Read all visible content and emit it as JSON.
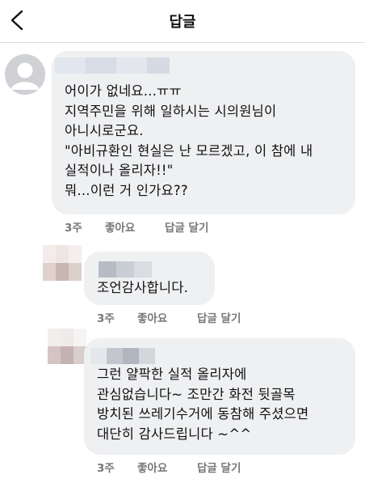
{
  "header": {
    "title": "답글",
    "back_icon": "chevron-left-icon"
  },
  "comments": [
    {
      "text": "어이가 없네요...ㅠㅠ\n지역주민을 위해 일하시는 시의원님이\n아니시로군요.\n\"아비규환인 현실은 난 모르겠고, 이 참에 내\n실적이나 올리자!!\"\n뭐...이런 거 인가요??",
      "time": "3주",
      "like": "좋아요",
      "reply": "답글 달기"
    },
    {
      "text": "조언감사합니다.",
      "time": "3주",
      "like": "좋아요",
      "reply": "답글 달기"
    },
    {
      "text": "그런 얄팍한 실적 올리자에\n관심없습니다~ 조만간 화전 뒷골목\n방치된 쓰레기수거에 동참해 주셨으면\n대단히 감사드립니다 ~^^",
      "time": "3주",
      "like": "좋아요",
      "reply": "답글 달기"
    }
  ],
  "colors": {
    "bubble": "#eff0f2",
    "meta_text": "#777777",
    "divider": "#dcdcdc"
  }
}
